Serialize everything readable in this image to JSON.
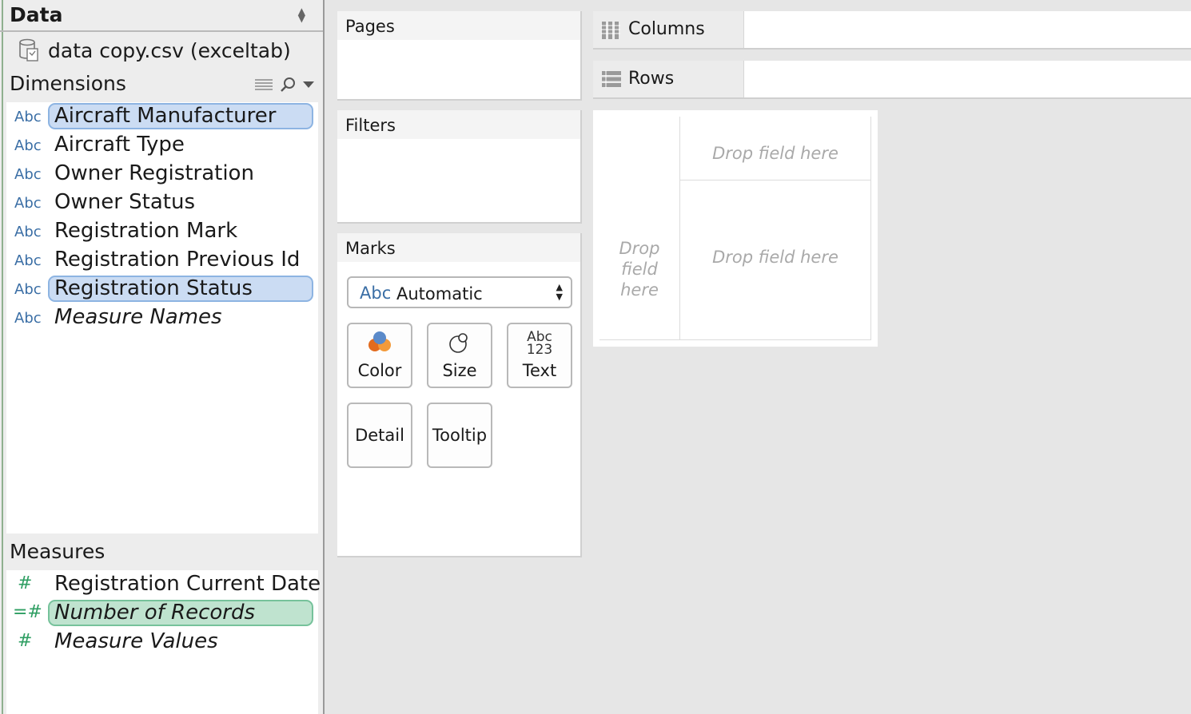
{
  "data_pane": {
    "title": "Data",
    "datasource": "data copy.csv (exceltab)",
    "dimensions_title": "Dimensions",
    "measures_title": "Measures",
    "dimensions": [
      {
        "type": "Abc",
        "label": "Aircraft Manufacturer"
      },
      {
        "type": "Abc",
        "label": "Aircraft Type"
      },
      {
        "type": "Abc",
        "label": "Owner Registration"
      },
      {
        "type": "Abc",
        "label": "Owner Status"
      },
      {
        "type": "Abc",
        "label": "Registration Mark"
      },
      {
        "type": "Abc",
        "label": "Registration Previous Id"
      },
      {
        "type": "Abc",
        "label": "Registration Status"
      },
      {
        "type": "Abc",
        "label": "Measure Names"
      }
    ],
    "measures": [
      {
        "type": "#",
        "label": "Registration Current Date"
      },
      {
        "type": "=#",
        "label": "Number of Records"
      },
      {
        "type": "#",
        "label": "Measure Values"
      }
    ]
  },
  "cards": {
    "pages": "Pages",
    "filters": "Filters",
    "marks": "Marks",
    "mark_type_icon": "Abc",
    "mark_type": "Automatic",
    "buttons": {
      "color": "Color",
      "size": "Size",
      "text": "Text",
      "text_icon_top": "Abc",
      "text_icon_bottom": "123",
      "detail": "Detail",
      "tooltip": "Tooltip"
    }
  },
  "shelves": {
    "columns": "Columns",
    "rows": "Rows"
  },
  "view": {
    "drop_columns": "Drop field here",
    "drop_rows": "Drop field here",
    "drop_main": "Drop field here"
  },
  "colors": {
    "dimension_icon": "#3a6ea5",
    "measure_icon": "#2e9e62",
    "selected_dimension": "#cbdcf3",
    "selected_measure": "#bfe3cf"
  }
}
